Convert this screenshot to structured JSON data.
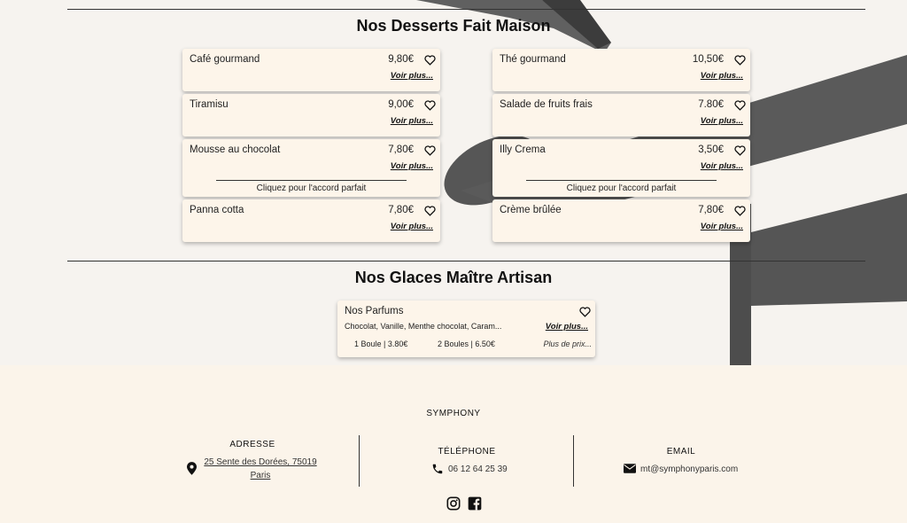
{
  "colors": {
    "card_bg": "#fdf5ea",
    "page_bg": "#fbf4ea",
    "text": "#1a1a1a"
  },
  "desserts": {
    "title": "Nos Desserts Fait Maison",
    "items": [
      {
        "name": "Café gourmand",
        "price": "9,80€",
        "more": "Voir plus..."
      },
      {
        "name": "Thé gourmand",
        "price": "10,50€",
        "more": "Voir plus..."
      },
      {
        "name": "Tiramisu",
        "price": "9,00€",
        "more": "Voir plus..."
      },
      {
        "name": "Salade de fruits frais",
        "price": "7.80€",
        "more": "Voir plus..."
      },
      {
        "name": "Mousse au chocolat",
        "price": "7,80€",
        "more": "Voir plus...",
        "pairing": "Cliquez pour l'accord parfait"
      },
      {
        "name": "Illy Crema",
        "price": "3,50€",
        "more": "Voir plus...",
        "pairing": "Cliquez pour l'accord parfait"
      },
      {
        "name": "Panna cotta",
        "price": "7,80€",
        "more": "Voir plus..."
      },
      {
        "name": "Crème brûlée",
        "price": "7,80€",
        "more": "Voir plus..."
      }
    ]
  },
  "glaces": {
    "title": "Nos Glaces Maître Artisan",
    "card": {
      "name": "Nos Parfums",
      "description": "Chocolat, Vanille, Menthe chocolat, Caram...",
      "more": "Voir plus...",
      "price_1": "1 Boule | 3.80€",
      "price_2": "2 Boules | 6.50€",
      "price_more": "Plus de prix..."
    }
  },
  "footer": {
    "brand": "SYMPHONY",
    "address": {
      "title": "ADRESSE",
      "line1": "25 Sente des Dorées, 75019",
      "line2": "Paris",
      "icon": "map-pin-icon"
    },
    "phone": {
      "title": "TÉLÉPHONE",
      "value": "06 12 64 25 39",
      "icon": "phone-icon"
    },
    "email": {
      "title": "EMAIL",
      "value": "mt@symphonyparis.com",
      "icon": "envelope-icon"
    },
    "social": [
      "instagram-icon",
      "facebook-icon"
    ]
  }
}
